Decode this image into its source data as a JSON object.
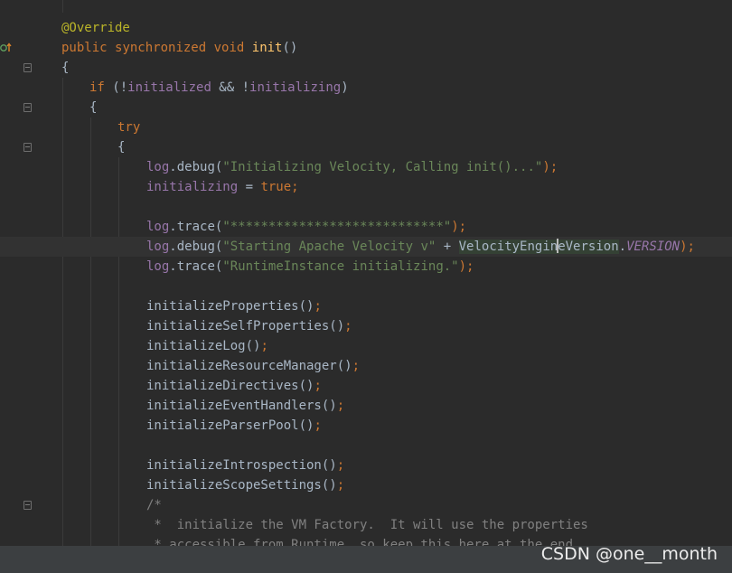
{
  "editor": {
    "lines": {
      "l1_annotation": "@Override",
      "l2_public": "public",
      "l2_synchronized": "synchronized",
      "l2_void": "void",
      "l2_method": "init",
      "l2_parens": "()",
      "l3_brace": "{",
      "l4_if": "if",
      "l4_open": " (!",
      "l4_initialized": "initialized",
      "l4_and": " && !",
      "l4_initializing": "initializing",
      "l4_close": ")",
      "l5_brace": "{",
      "l6_try": "try",
      "l7_brace": "{",
      "l8_log": "log",
      "l8_call": ".debug(",
      "l8_string": "\"Initializing Velocity, Calling init()...\"",
      "l8_end": ");",
      "l9_field": "initializing",
      "l9_assign": " = ",
      "l9_true": "true",
      "l9_semi": ";",
      "l11_log": "log",
      "l11_call": ".trace(",
      "l11_string": "\"****************************\"",
      "l11_end": ");",
      "l12_log": "log",
      "l12_call": ".debug(",
      "l12_string": "\"Starting Apache Velocity v\"",
      "l12_plus": " + ",
      "l12_class_a": "VelocityEngin",
      "l12_class_b": "eVersion",
      "l12_dot": ".",
      "l12_const": "VERSION",
      "l12_end": ");",
      "l13_log": "log",
      "l13_call": ".trace(",
      "l13_string": "\"RuntimeInstance initializing.\"",
      "l13_end": ");",
      "l15_call": "initializeProperties()",
      "l16_call": "initializeSelfProperties()",
      "l17_call": "initializeLog()",
      "l18_call": "initializeResourceManager()",
      "l19_call": "initializeDirectives()",
      "l20_call": "initializeEventHandlers()",
      "l21_call": "initializeParserPool()",
      "l23_call": "initializeIntrospection()",
      "l24_call": "initializeScopeSettings()",
      "semi": ";",
      "l25_comment": "/*",
      "l26_comment": " *  initialize the VM Factory.  It will use the properties",
      "l27_comment": " * accessible from Runtime, so keep this here at the end"
    }
  },
  "watermark": "CSDN @one__month",
  "colors": {
    "background": "#2b2b2b",
    "keyword": "#cc7832",
    "annotation": "#bbb529",
    "field": "#9876aa",
    "string": "#6a8759",
    "method_decl": "#ffc66d",
    "default_text": "#a9b7c6",
    "comment": "#808080"
  },
  "icons": {
    "gutter_override": "override-up-arrow-icon",
    "gutter_fold": "fold-marker-icon"
  }
}
